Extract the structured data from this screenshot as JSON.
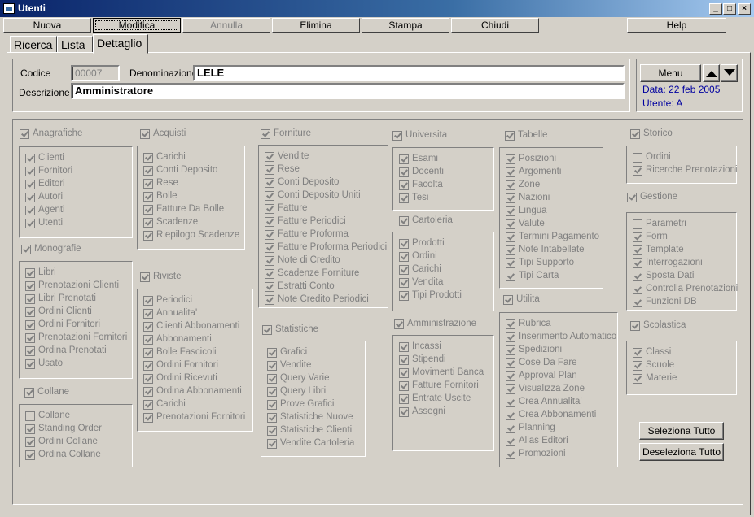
{
  "window": {
    "title": "Utenti"
  },
  "toolbar": {
    "nuova": "Nuova",
    "modifica": "Modifica",
    "annulla": "Annulla",
    "elimina": "Elimina",
    "stampa": "Stampa",
    "chiudi": "Chiudi",
    "help": "Help"
  },
  "tabs": [
    "Ricerca",
    "Lista",
    "Dettaglio"
  ],
  "form": {
    "codice_label": "Codice",
    "codice": "00007",
    "denominazione_label": "Denominazione",
    "denominazione": "LELE",
    "descrizione_label": "Descrizione",
    "descrizione": "Amministratore"
  },
  "side": {
    "menu": "Menu",
    "data": "Data: 22 feb 2005",
    "utente": "Utente: A"
  },
  "buttons": {
    "seleziona": "Seleziona Tutto",
    "deseleziona": "Deseleziona Tutto"
  },
  "groups": [
    {
      "title": "Anagrafiche",
      "on": true,
      "items": [
        [
          "Clienti",
          true
        ],
        [
          "Fornitori",
          true
        ],
        [
          "Editori",
          true
        ],
        [
          "Autori",
          true
        ],
        [
          "Agenti",
          true
        ],
        [
          "Utenti",
          true
        ]
      ]
    },
    {
      "title": "Monografie",
      "on": true,
      "items": [
        [
          "Libri",
          true
        ],
        [
          "Prenotazioni Clienti",
          true
        ],
        [
          "Libri Prenotati",
          true
        ],
        [
          "Ordini Clienti",
          true
        ],
        [
          "Ordini Fornitori",
          true
        ],
        [
          "Prenotazioni Fornitori",
          true
        ],
        [
          "Ordina Prenotati",
          true
        ],
        [
          "Usato",
          true
        ]
      ]
    },
    {
      "title": "Collane",
      "on": true,
      "items": [
        [
          "Collane",
          false
        ],
        [
          "Standing Order",
          true
        ],
        [
          "Ordini Collane",
          true
        ],
        [
          "Ordina Collane",
          true
        ]
      ]
    },
    {
      "title": "Acquisti",
      "on": true,
      "items": [
        [
          "Carichi",
          true
        ],
        [
          "Conti Deposito",
          true
        ],
        [
          "Rese",
          true
        ],
        [
          "Bolle",
          true
        ],
        [
          "Fatture Da Bolle",
          true
        ],
        [
          "Scadenze",
          true
        ],
        [
          "Riepilogo Scadenze",
          true
        ]
      ]
    },
    {
      "title": "Riviste",
      "on": true,
      "items": [
        [
          "Periodici",
          true
        ],
        [
          "Annualita'",
          true
        ],
        [
          "Clienti Abbonamenti",
          true
        ],
        [
          "Abbonamenti",
          true
        ],
        [
          "Bolle Fascicoli",
          true
        ],
        [
          "Ordini Fornitori",
          true
        ],
        [
          "Ordini Ricevuti",
          true
        ],
        [
          "Ordina Abbonamenti",
          true
        ],
        [
          "Carichi",
          true
        ],
        [
          "Prenotazioni Fornitori",
          true
        ]
      ]
    },
    {
      "title": "Forniture",
      "on": true,
      "items": [
        [
          "Vendite",
          true
        ],
        [
          "Rese",
          true
        ],
        [
          "Conti Deposito",
          true
        ],
        [
          "Conti Deposito Uniti",
          true
        ],
        [
          "Fatture",
          true
        ],
        [
          "Fatture Periodici",
          true
        ],
        [
          "Fatture Proforma",
          true
        ],
        [
          "Fatture Proforma Periodici",
          true
        ],
        [
          "Note di Credito",
          true
        ],
        [
          "Scadenze Forniture",
          true
        ],
        [
          "Estratti Conto",
          true
        ],
        [
          "Note Credito Periodici",
          true
        ]
      ]
    },
    {
      "title": "Statistiche",
      "on": true,
      "items": [
        [
          "Grafici",
          true
        ],
        [
          "Vendite",
          true
        ],
        [
          "Query Varie",
          true
        ],
        [
          "Query Libri",
          true
        ],
        [
          "Prove Grafici",
          true
        ],
        [
          "Statistiche Nuove",
          true
        ],
        [
          "Statistiche Clienti",
          true
        ],
        [
          "Vendite Cartoleria",
          true
        ]
      ]
    },
    {
      "title": "Universita",
      "on": true,
      "items": [
        [
          "Esami",
          true
        ],
        [
          "Docenti",
          true
        ],
        [
          "Facolta",
          true
        ],
        [
          "Tesi",
          true
        ]
      ]
    },
    {
      "title": "Cartoleria",
      "on": true,
      "items": [
        [
          "Prodotti",
          true
        ],
        [
          "Ordini",
          true
        ],
        [
          "Carichi",
          true
        ],
        [
          "Vendita",
          true
        ],
        [
          "Tipi Prodotti",
          true
        ]
      ]
    },
    {
      "title": "Amministrazione",
      "on": true,
      "items": [
        [
          "Incassi",
          true
        ],
        [
          "Stipendi",
          true
        ],
        [
          "Movimenti Banca",
          true
        ],
        [
          "Fatture Fornitori",
          true
        ],
        [
          "Entrate Uscite",
          true
        ],
        [
          "Assegni",
          true
        ]
      ]
    },
    {
      "title": "Tabelle",
      "on": true,
      "items": [
        [
          "Posizioni",
          true
        ],
        [
          "Argomenti",
          true
        ],
        [
          "Zone",
          true
        ],
        [
          "Nazioni",
          true
        ],
        [
          "Lingua",
          true
        ],
        [
          "Valute",
          true
        ],
        [
          "Termini Pagamento",
          true
        ],
        [
          "Note Intabellate",
          true
        ],
        [
          "Tipi Supporto",
          true
        ],
        [
          "Tipi Carta",
          true
        ]
      ]
    },
    {
      "title": "Utilita",
      "on": true,
      "items": [
        [
          "Rubrica",
          true
        ],
        [
          "Inserimento Automatico",
          true
        ],
        [
          "Spedizioni",
          true
        ],
        [
          "Cose Da Fare",
          true
        ],
        [
          "Approval Plan",
          true
        ],
        [
          "Visualizza Zone",
          true
        ],
        [
          "Crea Annualita'",
          true
        ],
        [
          "Crea Abbonamenti",
          true
        ],
        [
          "Planning",
          true
        ],
        [
          "Alias Editori",
          true
        ],
        [
          "Promozioni",
          true
        ]
      ]
    },
    {
      "title": "Storico",
      "on": true,
      "items": [
        [
          "Ordini",
          false
        ],
        [
          "Ricerche Prenotazioni",
          true
        ]
      ]
    },
    {
      "title": "Gestione",
      "on": true,
      "items": [
        [
          "Parametri",
          false
        ],
        [
          "Form",
          true
        ],
        [
          "Template",
          true
        ],
        [
          "Interrogazioni",
          true
        ],
        [
          "Sposta Dati",
          true
        ],
        [
          "Controlla Prenotazioni",
          true
        ],
        [
          "Funzioni DB",
          true
        ]
      ]
    },
    {
      "title": "Scolastica",
      "on": true,
      "items": [
        [
          "Classi",
          true
        ],
        [
          "Scuole",
          true
        ],
        [
          "Materie",
          true
        ]
      ]
    }
  ]
}
